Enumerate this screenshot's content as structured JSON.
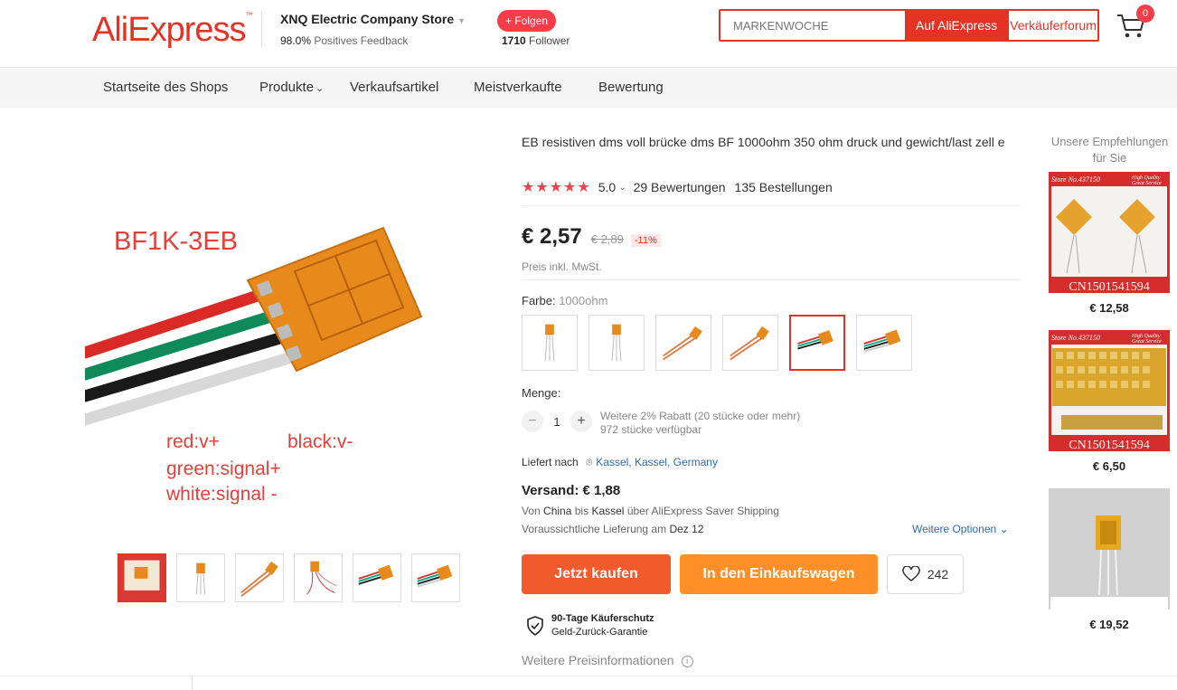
{
  "header": {
    "logo": "AliExpress",
    "store_name": "XNQ Electric Company Store",
    "feedback_value": "98.0%",
    "feedback_label": "Positives Feedback",
    "follow_label": "+ Folgen",
    "follower_count": "1710",
    "follower_label": "Follower",
    "search_placeholder": "MARKENWOCHE",
    "search_ali_label": "Auf AliExpress",
    "search_forum_label": "Verkäuferforum",
    "cart_count": "0"
  },
  "nav": {
    "items": [
      "Startseite des Shops",
      "Produkte",
      "Verkaufsartikel",
      "Meistverkaufte",
      "Bewertung"
    ]
  },
  "gallery": {
    "main_labels": {
      "model": "BF1K-3EB",
      "red": "red:v+",
      "black": "black:v-",
      "green": "green:signal+",
      "white": "white:signal -"
    }
  },
  "product": {
    "title": "EB resistiven dms voll brücke dms BF 1000ohm 350 ohm druck und gewicht/last zell e",
    "stars": "★★★★★",
    "rating": "5.0",
    "reviews": "29 Bewertungen",
    "orders": "135 Bestellungen",
    "price": "€ 2,57",
    "price_old": "€ 2,89",
    "discount": "-11%",
    "vat": "Preis inkl. MwSt.",
    "color_label": "Farbe:",
    "color_value": "1000ohm",
    "quantity_label": "Menge:",
    "quantity": "1",
    "qty_info1": "Weitere 2% Rabatt (20 stücke oder mehr)",
    "qty_info2": "972 stücke verfügbar",
    "ships_to_label": "Liefert nach",
    "ships_to_location": "Kassel, Kassel, Germany",
    "shipping_cost": "Versand: € 1,88",
    "shipping_line1_a": "Von",
    "shipping_line1_from": "China",
    "shipping_line1_b": "bis",
    "shipping_line1_to": "Kassel",
    "shipping_line1_c": "über AliExpress Saver Shipping",
    "shipping_line2_a": "Voraussichtliche Lieferung am",
    "shipping_line2_date": "Dez 12",
    "more_options": "Weitere Optionen",
    "buy_now": "Jetzt kaufen",
    "add_to_cart": "In den Einkaufswagen",
    "wishlist_count": "242",
    "protection_title": "90-Tage Käuferschutz",
    "protection_sub": "Geld-Zurück-Garantie",
    "more_price_info": "Weitere Preisinformationen"
  },
  "recommendations": {
    "title": "Unsere Empfehlungen für Sie",
    "items": [
      {
        "price": "€ 12,58",
        "store": "Store No.437150",
        "tagline1": "High Quality",
        "tagline2": "Great Service",
        "code": "CN1501541594"
      },
      {
        "price": "€ 6,50",
        "store": "Store No.437150",
        "tagline1": "High Quality",
        "tagline2": "Great Service",
        "code": "CN1501541594"
      },
      {
        "price": "€ 19,52"
      }
    ]
  }
}
